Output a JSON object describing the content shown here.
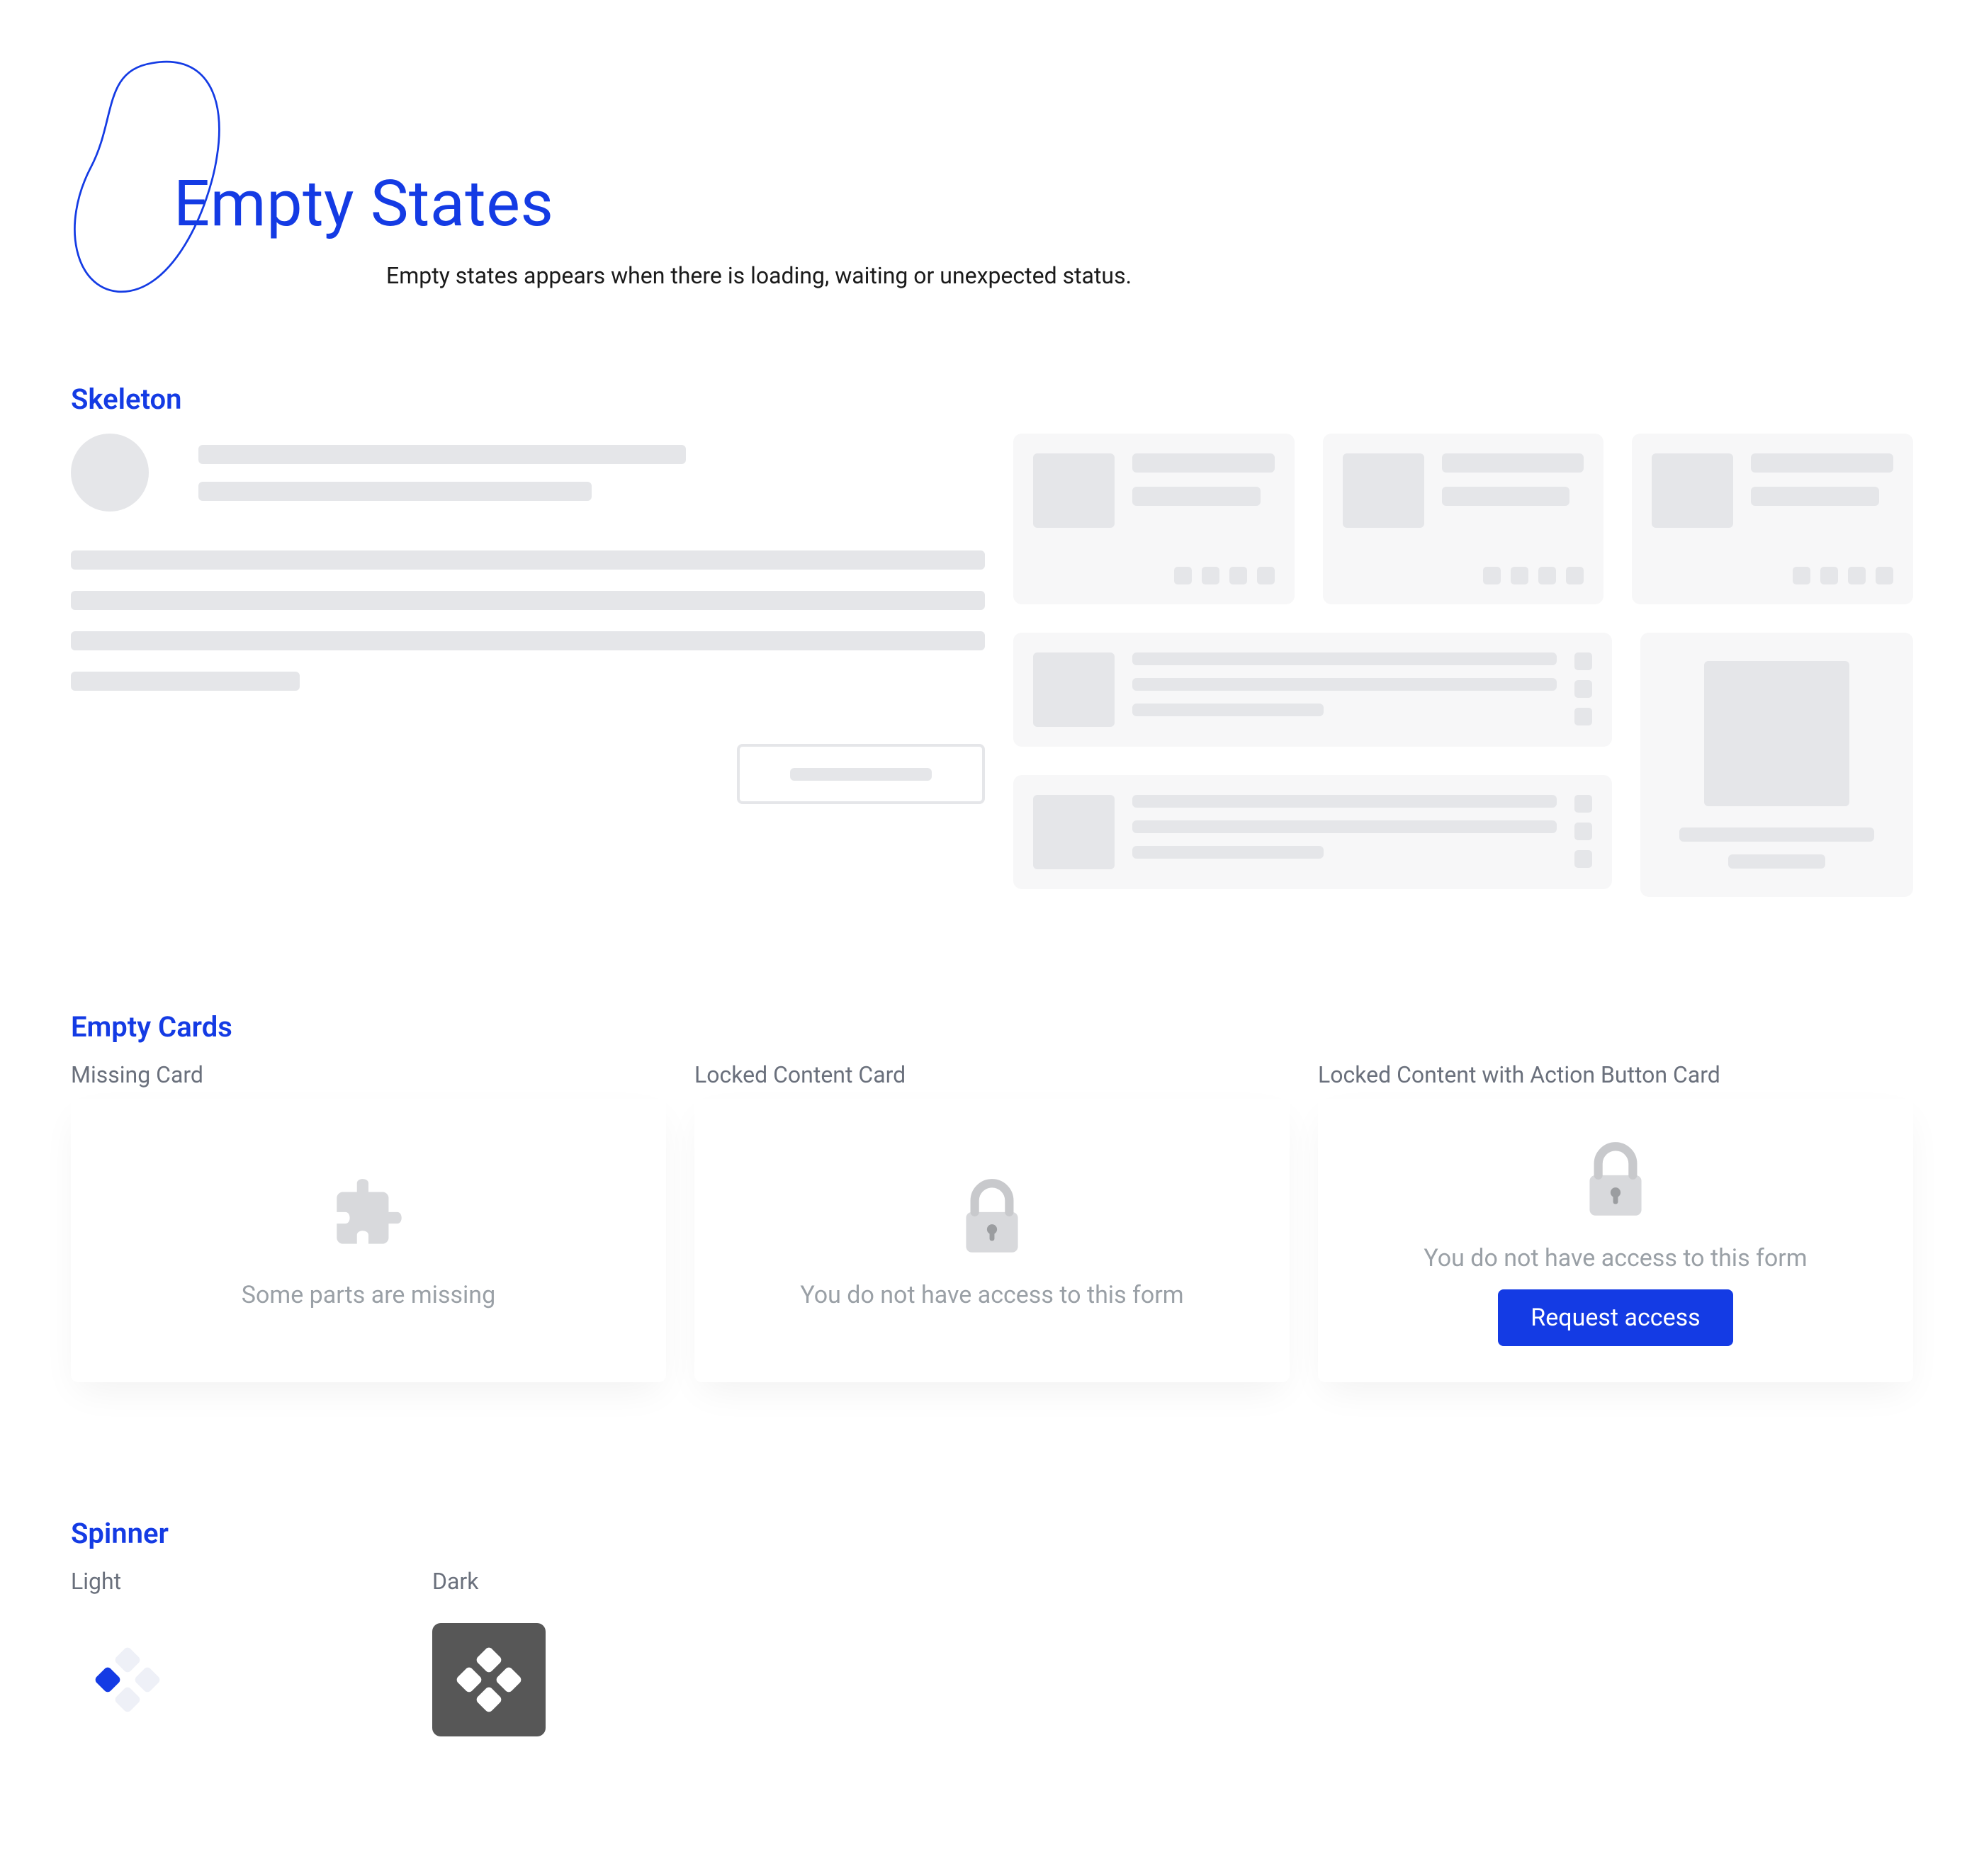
{
  "hero": {
    "title": "Empty States",
    "subtitle": "Empty states appears when there is loading, waiting or unexpected status."
  },
  "sections": {
    "skeleton": {
      "heading": "Skeleton"
    },
    "emptyCards": {
      "heading": "Empty Cards",
      "variants": [
        {
          "label": "Missing Card",
          "message": "Some parts are missing"
        },
        {
          "label": "Locked Content Card",
          "message": "You do not have access to this form"
        },
        {
          "label": "Locked Content with Action Button Card",
          "message": "You do not have access to this form",
          "action": "Request access"
        }
      ]
    },
    "spinner": {
      "heading": "Spinner",
      "variants": [
        {
          "label": "Light"
        },
        {
          "label": "Dark"
        }
      ]
    }
  },
  "colors": {
    "primary": "#143BE4",
    "skeleton": "#e5e6e9"
  }
}
